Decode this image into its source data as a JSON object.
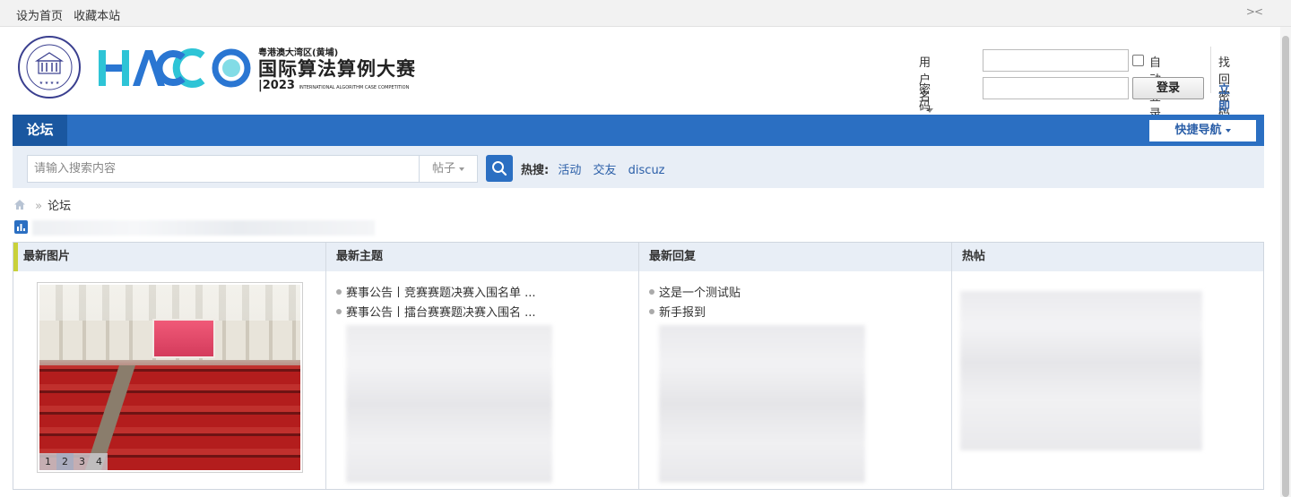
{
  "topbar": {
    "links": [
      "设为首页",
      "收藏本站"
    ],
    "collapse_icon": "collapse-icon"
  },
  "header": {
    "logo": {
      "line1": "粤港澳大湾区(黄埔)",
      "line2": "国际算法算例大赛",
      "line3": "2023",
      "line3_sub": "INTERNATIONAL ALGORITHM CASE COMPETITION",
      "seal_text": "PAZHOU LAB HUANGPU"
    },
    "login": {
      "username_label": "用户名",
      "password_label": "密码",
      "auto_login_label": "自动登录",
      "login_button": "登录",
      "forgot_password": "找回密码",
      "register": "立即注册"
    }
  },
  "nav": {
    "active_tab": "论坛",
    "quick_nav": "快捷导航"
  },
  "search": {
    "placeholder": "请输入搜索内容",
    "type": "帖子",
    "hot_label": "热搜:",
    "hot_terms": [
      "活动",
      "交友",
      "discuz"
    ]
  },
  "breadcrumb": {
    "home_icon": "home-icon",
    "separator": "»",
    "current": "论坛"
  },
  "columns": {
    "latest_pics": {
      "title": "最新图片",
      "pager": [
        "1",
        "2",
        "3",
        "4"
      ],
      "current_page": 2
    },
    "latest_topics": {
      "title": "最新主题",
      "items": [
        "赛事公告丨竞赛赛题决赛入围名单 ...",
        "赛事公告丨擂台赛赛题决赛入围名 ..."
      ]
    },
    "latest_replies": {
      "title": "最新回复",
      "items": [
        "这是一个测试贴",
        "新手报到"
      ]
    },
    "hot_posts": {
      "title": "热帖"
    }
  },
  "colors": {
    "nav_blue": "#2b6fc2",
    "nav_dark": "#1a57a0",
    "link_blue": "#2b5fa8",
    "accent": "#c9d13a",
    "panel_bg": "#e8eef6"
  }
}
